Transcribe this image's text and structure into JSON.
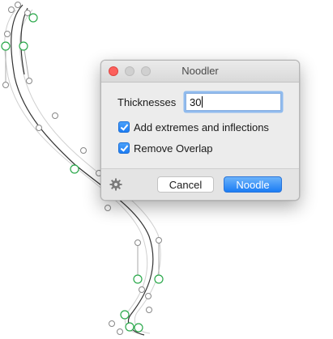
{
  "dialog": {
    "title": "Noodler",
    "thickness_label": "Thicknesses",
    "thickness_value": "30",
    "option_extremes": {
      "label": "Add extremes and inflections",
      "checked": true
    },
    "option_overlap": {
      "label": "Remove Overlap",
      "checked": true
    },
    "cancel_label": "Cancel",
    "noodle_label": "Noodle",
    "settings_icon": "gear-icon"
  },
  "colors": {
    "accent": "#1d7cf2",
    "close_button": "#fc605c",
    "node_on_curve": "#2aa84a",
    "outline": "#333333",
    "guide": "#bdbdbd"
  }
}
